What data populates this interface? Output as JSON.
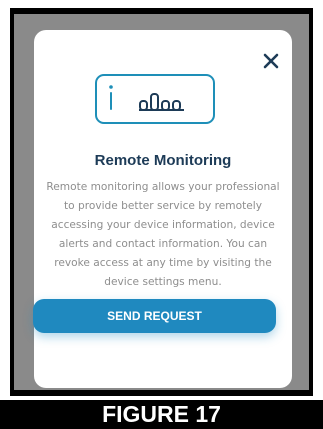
{
  "modal": {
    "title": "Remote Monitoring",
    "description": "Remote monitoring allows your professional to provide better service by remotely accessing your device information, device alerts and contact information. You can revoke access at any time by visiting the device settings menu.",
    "send_button_label": "SEND REQUEST",
    "close_icon": "close-icon",
    "device_icon": "device-monitor-icon"
  },
  "caption": {
    "text": "FIGURE 17"
  },
  "colors": {
    "accent": "#1f89bf",
    "title": "#1d3b57",
    "body_text": "#8e8e8e",
    "backdrop": "#8a8a8a"
  }
}
